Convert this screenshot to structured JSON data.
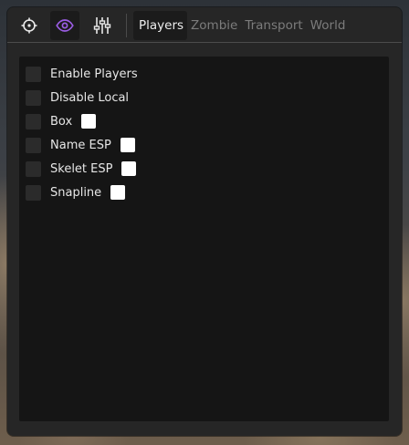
{
  "toolbar": {
    "buttons": [
      {
        "icon": "crosshair-icon",
        "active": false
      },
      {
        "icon": "eye-icon",
        "active": true,
        "color": "#9b5de5"
      },
      {
        "icon": "sliders-icon",
        "active": false
      }
    ]
  },
  "tabs": [
    {
      "label": "Players",
      "active": true
    },
    {
      "label": "Zombie",
      "active": false
    },
    {
      "label": "Transport",
      "active": false
    },
    {
      "label": "World",
      "active": false
    }
  ],
  "options": [
    {
      "label": "Enable Players",
      "checked": false
    },
    {
      "label": "Disable Local",
      "checked": false
    },
    {
      "label": "Box",
      "checked": false,
      "color": "#ffffff"
    },
    {
      "label": "Name ESP",
      "checked": false,
      "color": "#ffffff"
    },
    {
      "label": "Skelet ESP",
      "checked": false,
      "color": "#ffffff"
    },
    {
      "label": "Snapline",
      "checked": false,
      "color": "#ffffff"
    }
  ]
}
